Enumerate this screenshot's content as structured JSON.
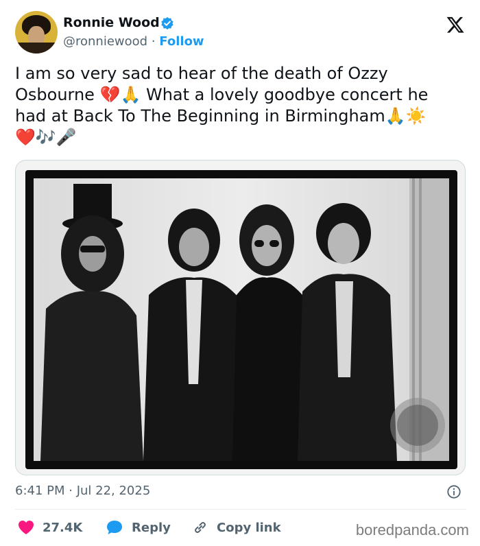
{
  "author": {
    "name": "Ronnie Wood",
    "handle": "@ronniewood",
    "separator": "·",
    "follow_label": "Follow",
    "verified_color": "#1d9bf0"
  },
  "tweet": {
    "line1": "I am so very sad to hear of the death of Ozzy",
    "line2": "Osbourne 💔🙏 What a lovely goodbye concert he",
    "line3": "had at Back To The Beginning in Birmingham🙏☀️",
    "line4": "❤️🎶🎤"
  },
  "photo": {
    "icon": "photo-of-four-musicians"
  },
  "timestamp": "6:41 PM · Jul 22, 2025",
  "actions": {
    "likes": "27.4K",
    "reply_label": "Reply",
    "copy_link_label": "Copy link",
    "like_color": "#f91880",
    "reply_color": "#1d9bf0"
  },
  "watermark": "boredpanda.com"
}
